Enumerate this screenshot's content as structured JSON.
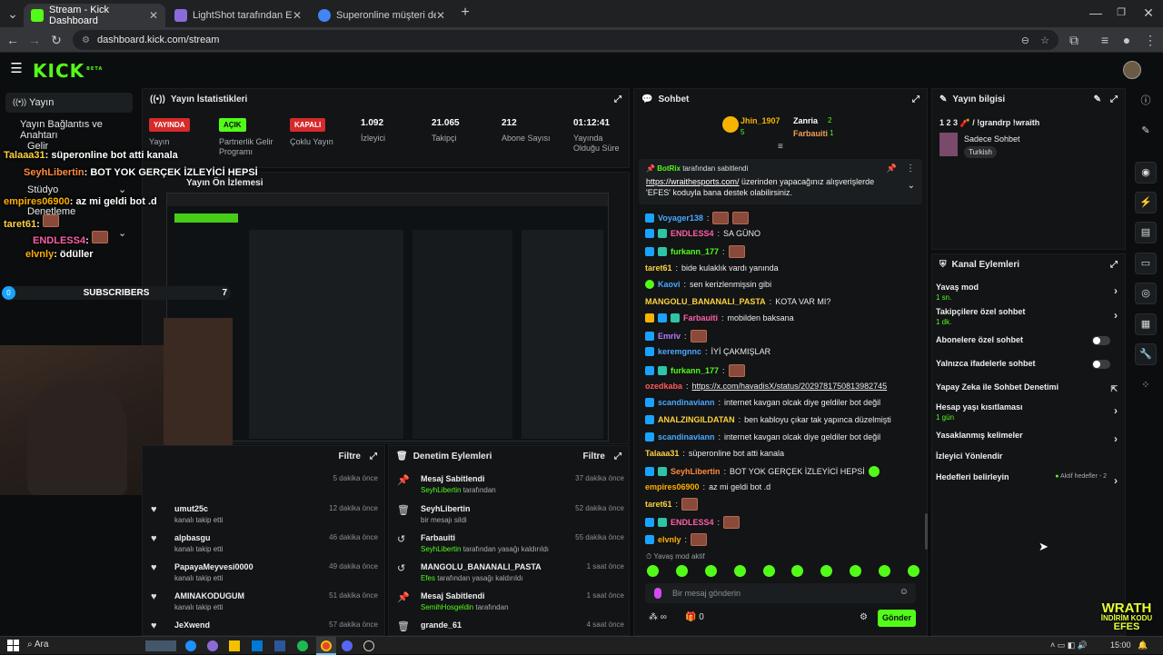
{
  "browser": {
    "tabs": [
      {
        "label": "Stream - Kick Dashboard",
        "color": "#53fc18"
      },
      {
        "label": "LightShot tarafından Ekran Gör",
        "color": "#8a6bd8"
      },
      {
        "label": "Superonline müşteri destek - G",
        "color": "#4285f4"
      }
    ],
    "url": "dashboard.kick.com/stream"
  },
  "kick": {
    "logo": "KICK",
    "logo_sup": "BETA"
  },
  "sidebar": {
    "items": [
      "Yayın",
      "Yayın Bağlantıs ve Anahtarı",
      "Gelir",
      "Stüdyo",
      "Denetleme"
    ],
    "subscribers_label": "SUBSCRIBERS",
    "subscribers_count": "0",
    "subscribers_goal": "7"
  },
  "overlay_chat": [
    {
      "user": "Talaaa31",
      "text": ": süperonline bot atti kanala",
      "user_color": "#ffd23e"
    },
    {
      "user": "SeyhLibertin",
      "text": ": BOT YOK GERÇEK İZLEYİCİ HEPSİ",
      "user_color": "#ff8a3d"
    },
    {
      "user": "empires06900",
      "text": ": az mi geldi bot .d",
      "user_color": "#ffb000"
    },
    {
      "user": "taret61",
      "text": ":",
      "user_color": "#ffd23e"
    },
    {
      "user": "ENDLESS4",
      "text": ":",
      "user_color": "#ff5ea8"
    },
    {
      "user": "elvnly",
      "text": ": ödüller",
      "user_color": "#ffb000"
    }
  ],
  "stats": {
    "title": "Yayın İstatistikleri",
    "items": [
      {
        "badge": "YAYINDA",
        "label": "Yayın",
        "badge_color": "#d72a2a"
      },
      {
        "badge": "AÇIK",
        "label": "Partnerlik Gelir Programı",
        "badge_color": "#53fc18"
      },
      {
        "badge": "KAPALI",
        "label": "Çoklu Yayın",
        "badge_color": "#d72a2a"
      },
      {
        "value": "1.092",
        "label": "İzleyici"
      },
      {
        "value": "21.065",
        "label": "Takipçi"
      },
      {
        "value": "212",
        "label": "Abone Sayısı"
      },
      {
        "value": "01:12:41",
        "label": "Yayında Olduğu Süre"
      }
    ]
  },
  "preview": {
    "title": "Yayın Ön İzlemesi"
  },
  "activity": {
    "filter_label": "Filtre",
    "rows": [
      {
        "user": "",
        "sub": "",
        "time": "5 dakika önce"
      },
      {
        "user": "umut25c",
        "sub": "kanalı takip etti",
        "time": "12 dakika önce"
      },
      {
        "user": "alpbasgu",
        "sub": "kanalı takip etti",
        "time": "46 dakika önce"
      },
      {
        "user": "PapayaMeyvesi0000",
        "sub": "kanalı takip etti",
        "time": "49 dakika önce"
      },
      {
        "user": "AMINAKODUGUM",
        "sub": "kanalı takip etti",
        "time": "51 dakika önce"
      },
      {
        "user": "JeXwend",
        "sub": "",
        "time": "57 dakika önce"
      }
    ]
  },
  "moderation": {
    "title": "Denetim Eylemleri",
    "filter_label": "Filtre",
    "rows": [
      {
        "icon": "pin",
        "title": "Mesaj Sabitlendi",
        "actor": "SeyhLibertin",
        "rest": " tarafından",
        "time": "37 dakika önce"
      },
      {
        "icon": "trash",
        "title": "SeyhLibertin",
        "actor": "",
        "rest": "bir mesajı sildi",
        "time": "52 dakika önce"
      },
      {
        "icon": "undo",
        "title": "Farbauiti",
        "actor": "SeyhLibertin",
        "rest": " tarafından yasağı kaldırıldı",
        "time": "55 dakika önce"
      },
      {
        "icon": "undo",
        "title": "MANGOLU_BANANALI_PASTA",
        "actor": "Efes",
        "rest": " tarafından yasağı kaldırıldı",
        "time": "1 saat önce"
      },
      {
        "icon": "pin",
        "title": "Mesaj Sabitlendi",
        "actor": "SemihHosgeldin",
        "rest": " tarafından",
        "time": "1 saat önce"
      },
      {
        "icon": "trash",
        "title": "grande_61",
        "actor": "",
        "rest": "",
        "time": "4 saat önce"
      }
    ]
  },
  "chat": {
    "title": "Sohbet",
    "top_gifters": [
      {
        "name": "Jhin_1907",
        "count": "5"
      },
      {
        "name": "Zanria",
        "count": "2"
      },
      {
        "name": "Farbauiti",
        "count": "1"
      }
    ],
    "pinned": {
      "user": "BotRix",
      "label": " tarafından sabitlendi",
      "link": "https://wraithesports.com/",
      "text": " üzerinden yapacağınız alışverişlerde 'EFES' koduyla bana destek olabilirsiniz."
    },
    "messages": [
      {
        "user": "Voyager138",
        "text": "",
        "color": "#4aa8ff",
        "emote": true
      },
      {
        "user": "ENDLESS4",
        "text": "SA GÜNO",
        "color": "#ff5ea8",
        "emote": false
      },
      {
        "user": "furkann_177",
        "text": "",
        "color": "#53fc18",
        "emote": true
      },
      {
        "user": "taret61",
        "text": "bide kulaklık vardı yanında",
        "color": "#ffd23e",
        "emote": false
      },
      {
        "user": "Kaovi",
        "text": "sen kerizlenmişsin gibi",
        "color": "#4aa8ff",
        "emote": false
      },
      {
        "user": "MANGOLU_BANANALI_PASTA",
        "text": "KOTA VAR MI?",
        "color": "#ffd23e",
        "emote": false
      },
      {
        "user": "Farbauiti",
        "text": "mobilden baksana",
        "color": "#ff5ea8",
        "emote": false
      },
      {
        "user": "Emriv",
        "text": "",
        "color": "#b07cff",
        "emote": true
      },
      {
        "user": "keremgnnc",
        "text": "İYİ ÇAKMIŞLAR",
        "color": "#4aa8ff",
        "emote": false
      },
      {
        "user": "furkann_177",
        "text": "",
        "color": "#53fc18",
        "emote": true
      },
      {
        "user": "ozedkaba",
        "text": "https://x.com/havadisX/status/2029781750813982745",
        "color": "#ff5a5a",
        "emote": false
      },
      {
        "user": "scandinaviann",
        "text": "internet kavgan olcak diye geldiler bot değil",
        "color": "#4aa8ff",
        "emote": false
      },
      {
        "user": "ANALZINGILDATAN",
        "text": "ben kabloyu çıkar tak yapınca düzelmişti",
        "color": "#ffd23e",
        "emote": false
      },
      {
        "user": "scandinaviann",
        "text": "internet kavgan olcak diye geldiler bot değil",
        "color": "#4aa8ff",
        "emote": false
      },
      {
        "user": "Talaaa31",
        "text": "süperonline bot atti kanala",
        "color": "#ffd23e",
        "emote": false
      },
      {
        "user": "SeyhLibertin",
        "text": "BOT YOK GERÇEK İZLEYİCİ HEPSİ",
        "color": "#ff8a3d",
        "emote": false
      },
      {
        "user": "empires06900",
        "text": "az mi geldi bot .d",
        "color": "#ffb000",
        "emote": false
      },
      {
        "user": "taret61",
        "text": "",
        "color": "#ffd23e",
        "emote": true
      },
      {
        "user": "ENDLESS4",
        "text": "",
        "color": "#ff5ea8",
        "emote": true
      },
      {
        "user": "elvnly",
        "text": "",
        "color": "#ffb000",
        "emote": true
      }
    ],
    "slow_mode": "Yavaş mod aktif",
    "input_placeholder": "Bir mesaj gönderin",
    "points": "0",
    "send_label": "Gönder"
  },
  "stream_info": {
    "title": "Yayın bilgisi",
    "stream_title": "1 2 3 🧨 / !grandrp !wraith",
    "category": "Sadece Sohbet",
    "tag": "Turkish"
  },
  "channel_actions": {
    "title": "Kanal Eylemleri",
    "rows": [
      {
        "label": "Yavaş mod",
        "sub": "1 sn.",
        "control": "chevron"
      },
      {
        "label": "Takipçilere özel sohbet",
        "sub": "1 dk.",
        "control": "chevron"
      },
      {
        "label": "Abonelere özel sohbet",
        "sub": "",
        "control": "toggle"
      },
      {
        "label": "Yalnızca ifadelerle sohbet",
        "sub": "",
        "control": "toggle"
      },
      {
        "label": "Yapay Zeka ile Sohbet Denetimi",
        "sub": "",
        "control": "external"
      },
      {
        "label": "Hesap yaşı kısıtlaması",
        "sub": "1 gün",
        "control": "chevron"
      },
      {
        "label": "Yasaklanmış kelimeler",
        "sub": "",
        "control": "chevron"
      },
      {
        "label": "İzleyici Yönlendir",
        "sub": "",
        "control": "none"
      },
      {
        "label": "Hedefleri belirleyin",
        "sub": "",
        "control": "chevron"
      }
    ],
    "goals_status": "Aktif hedefler - 2"
  },
  "watermark": {
    "line1": "WRATH",
    "line2": "İNDİRİM KODU",
    "line3": "EFES"
  },
  "taskbar": {
    "search": "Ara",
    "time": "15:00"
  }
}
